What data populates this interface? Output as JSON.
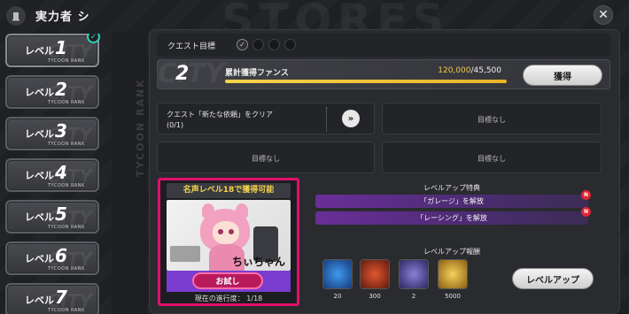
{
  "header": {
    "title": "実力者 シ"
  },
  "levels": [
    {
      "label": "レベル",
      "num": "1",
      "sub": "TYCOON RANK",
      "completed": true
    },
    {
      "label": "レベル",
      "num": "2",
      "sub": "TYCOON RANK"
    },
    {
      "label": "レベル",
      "num": "3",
      "sub": "TYCOON RANK"
    },
    {
      "label": "レベル",
      "num": "4",
      "sub": "TYCOON RANK"
    },
    {
      "label": "レベル",
      "num": "5",
      "sub": "TYCOON RANK"
    },
    {
      "label": "レベル",
      "num": "6",
      "sub": "TYCOON RANK"
    },
    {
      "label": "レベル",
      "num": "7",
      "sub": "TYCOON RANK"
    }
  ],
  "side_text": "TYCOON RANK",
  "quest": {
    "goal_label": "クエスト目標",
    "main": {
      "number": "2",
      "label": "累計獲得ファンス",
      "current": "120,000",
      "target": "/45,500",
      "progress": 1.0,
      "button": "獲得"
    },
    "sub": [
      {
        "text": "クエスト「新たな依頼」をクリア",
        "progress": "(0/1)"
      },
      {
        "text": "目標なし"
      },
      {
        "text": "目標なし"
      },
      {
        "text": "目標なし"
      }
    ]
  },
  "fame": {
    "title": "名声レベル18で獲得可能",
    "character_name": "ちぃちゃん",
    "try_button": "お試し",
    "progress_label": "現在の進行度：",
    "progress_value": "1/18"
  },
  "perks": {
    "title": "レベルアップ特典",
    "items": [
      "「ガレージ」を解放",
      "「レーシング」を解放"
    ]
  },
  "rewards": {
    "title": "レベルアップ報酬",
    "items": [
      {
        "icon": "blue-orb-icon",
        "count": "20",
        "color": "#2a6fd6"
      },
      {
        "icon": "ticket-icon",
        "count": "300",
        "color": "#b8341f"
      },
      {
        "icon": "card-icon",
        "count": "2",
        "color": "#5a4fa0"
      },
      {
        "icon": "gold-coin-icon",
        "count": "5000",
        "color": "#d9a520"
      }
    ],
    "levelup_button": "レベルアップ"
  }
}
